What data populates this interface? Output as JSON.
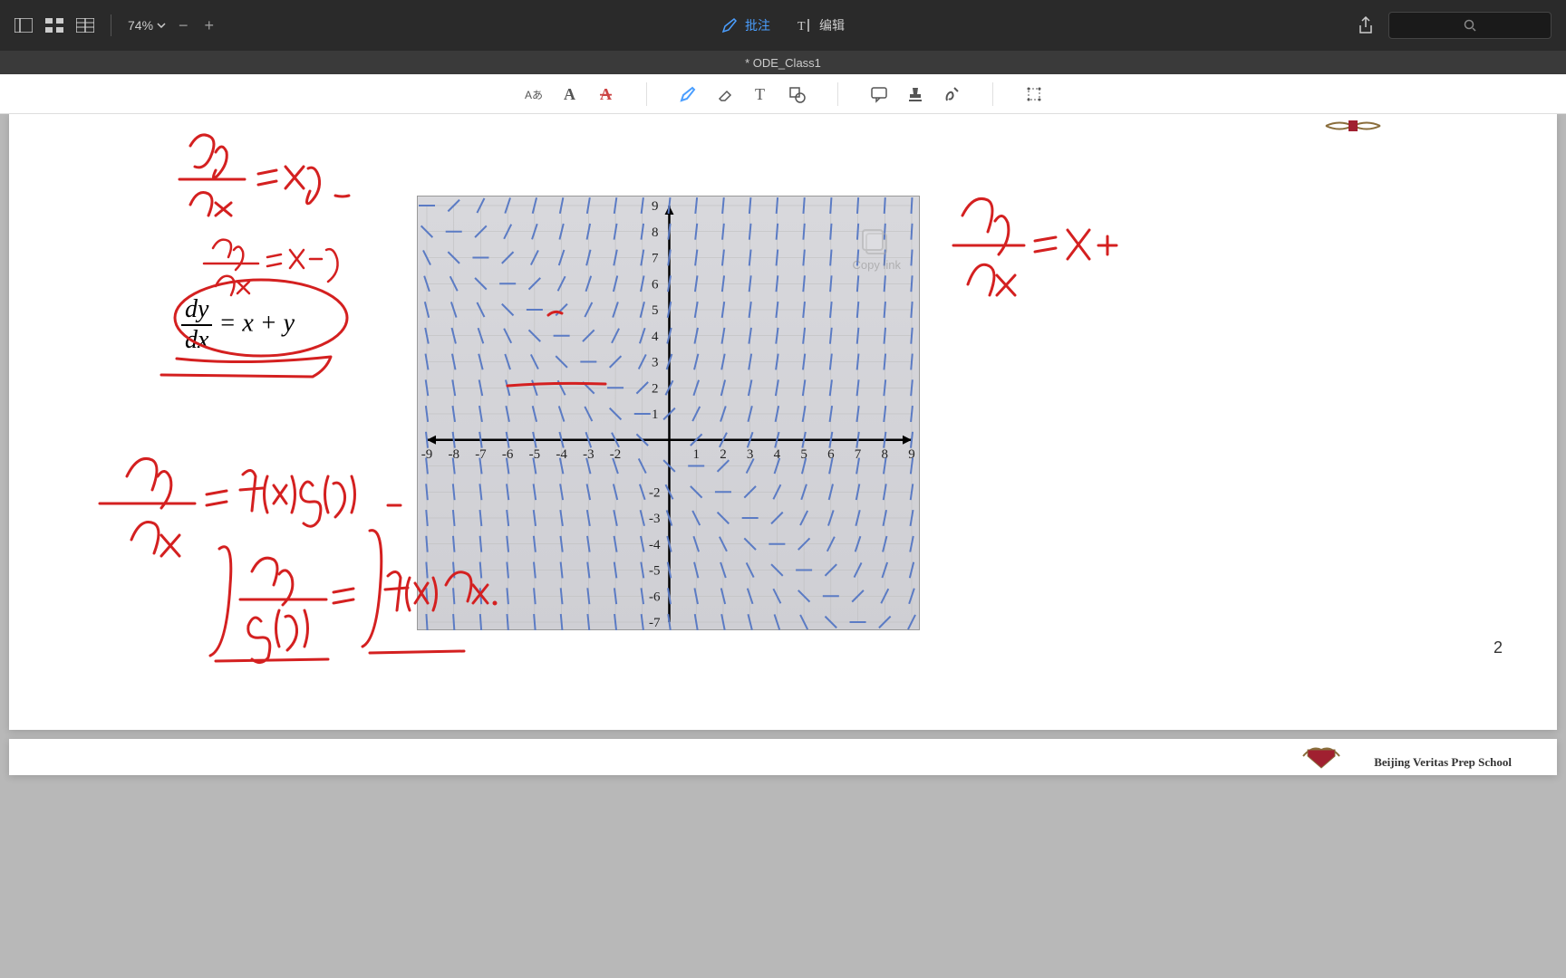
{
  "toolbar": {
    "zoom": "74%",
    "annotate_label": "批注",
    "edit_label": "编辑"
  },
  "title": "* ODE_Class1",
  "page": {
    "number": "2",
    "school_name": "Beijing Veritas Prep School",
    "copy_link": "Copy link"
  },
  "math": {
    "printed": {
      "lhs_num": "dy",
      "lhs_den": "dx",
      "eq": " = ",
      "rhs": "x + y"
    }
  },
  "chart_data": {
    "type": "slope-field",
    "title": "",
    "xlabel": "",
    "ylabel": "",
    "xlim": [
      -9,
      9
    ],
    "ylim": [
      -7,
      9
    ],
    "x_ticks": [
      -9,
      -8,
      -7,
      -6,
      -5,
      -4,
      -3,
      -2,
      1,
      2,
      3,
      4,
      5,
      6,
      7,
      8,
      9
    ],
    "y_ticks_pos": [
      1,
      2,
      3,
      4,
      5,
      6,
      7,
      8,
      9
    ],
    "y_ticks_neg": [
      -2,
      -3,
      -4,
      -5,
      -6,
      -7
    ],
    "equation": "dy/dx = x + y",
    "note": "slope segments drawn at integer lattice points with slope = x + y"
  },
  "handwriting": {
    "eq1": "dy/dx = xy",
    "eq2": "dy/dx = x - y",
    "eq3_circled": "dy/dx = x + y",
    "eq4": "dy/dx = f(x) g(y)",
    "eq5": "∫ dy / g(y) = ∫ f(x) dx",
    "eq_right": "dy/dx = x +"
  }
}
